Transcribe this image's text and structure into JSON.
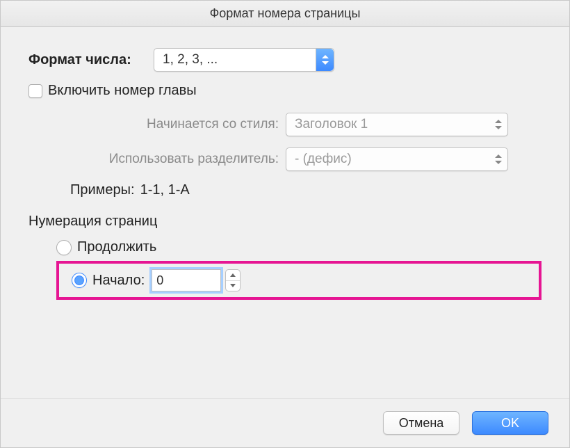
{
  "title": "Формат номера страницы",
  "numberFormat": {
    "label": "Формат числа:",
    "value": "1, 2, 3, ..."
  },
  "includeChapter": {
    "label": "Включить номер главы",
    "checked": false
  },
  "startsWithStyle": {
    "label": "Начинается со стиля:",
    "value": "Заголовок 1"
  },
  "separator": {
    "label": "Использовать разделитель:",
    "value": "-    (дефис)"
  },
  "examples": {
    "label": "Примеры:",
    "value": "1-1, 1-A"
  },
  "pageNumbering": {
    "heading": "Нумерация страниц",
    "continueLabel": "Продолжить",
    "startAtLabel": "Начало:",
    "startAtValue": "0",
    "selected": "startAt"
  },
  "buttons": {
    "cancel": "Отмена",
    "ok": "OK"
  }
}
